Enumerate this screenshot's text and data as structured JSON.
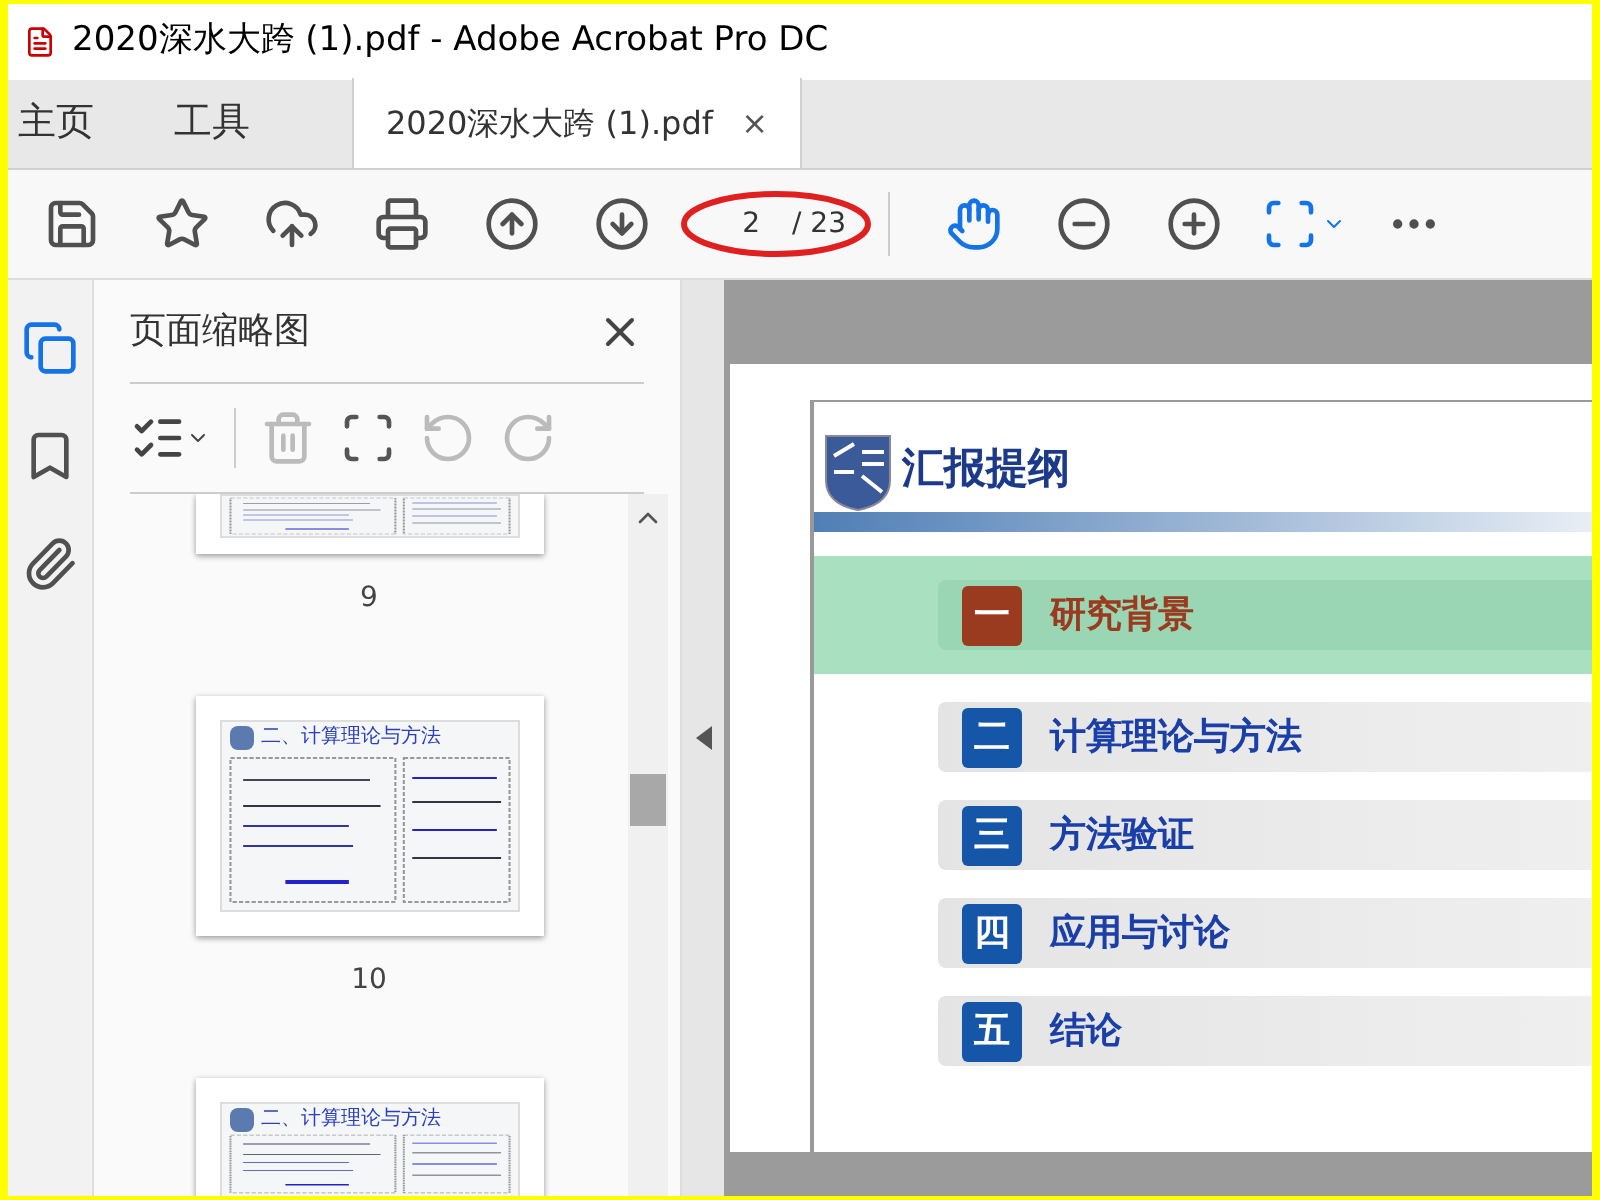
{
  "window": {
    "title": "2020深水大跨 (1).pdf - Adobe Acrobat Pro DC"
  },
  "tabs": [
    {
      "kind": "nav",
      "label": "主页",
      "selected": false
    },
    {
      "kind": "nav",
      "label": "工具",
      "selected": false
    },
    {
      "kind": "document",
      "label": "2020深水大跨 (1).pdf",
      "selected": true,
      "close": "×"
    }
  ],
  "toolbar": {
    "page_input": "2",
    "page_total": "/ 23",
    "hand_tool": {
      "selected": true
    }
  },
  "side_rail": [
    {
      "kind": "pages",
      "selected": true
    },
    {
      "kind": "bookmarks",
      "selected": false
    },
    {
      "kind": "attachments",
      "selected": false
    }
  ],
  "thumbnail_panel": {
    "title": "页面缩略图",
    "thumbnails": [
      {
        "kind": "tail",
        "page": "9"
      },
      {
        "kind": "full",
        "page": "10",
        "heading": "二、计算理论与方法"
      },
      {
        "kind": "head",
        "heading": "二、计算理论与方法"
      }
    ]
  },
  "slide": {
    "title": "汇报提纲",
    "items": [
      {
        "numeral": "一",
        "label": "研究背景",
        "selected": true
      },
      {
        "numeral": "二",
        "label": "计算理论与方法",
        "selected": false
      },
      {
        "numeral": "三",
        "label": "方法验证",
        "selected": false
      },
      {
        "numeral": "四",
        "label": "应用与讨论",
        "selected": false
      },
      {
        "numeral": "五",
        "label": "结论",
        "selected": false
      }
    ]
  }
}
